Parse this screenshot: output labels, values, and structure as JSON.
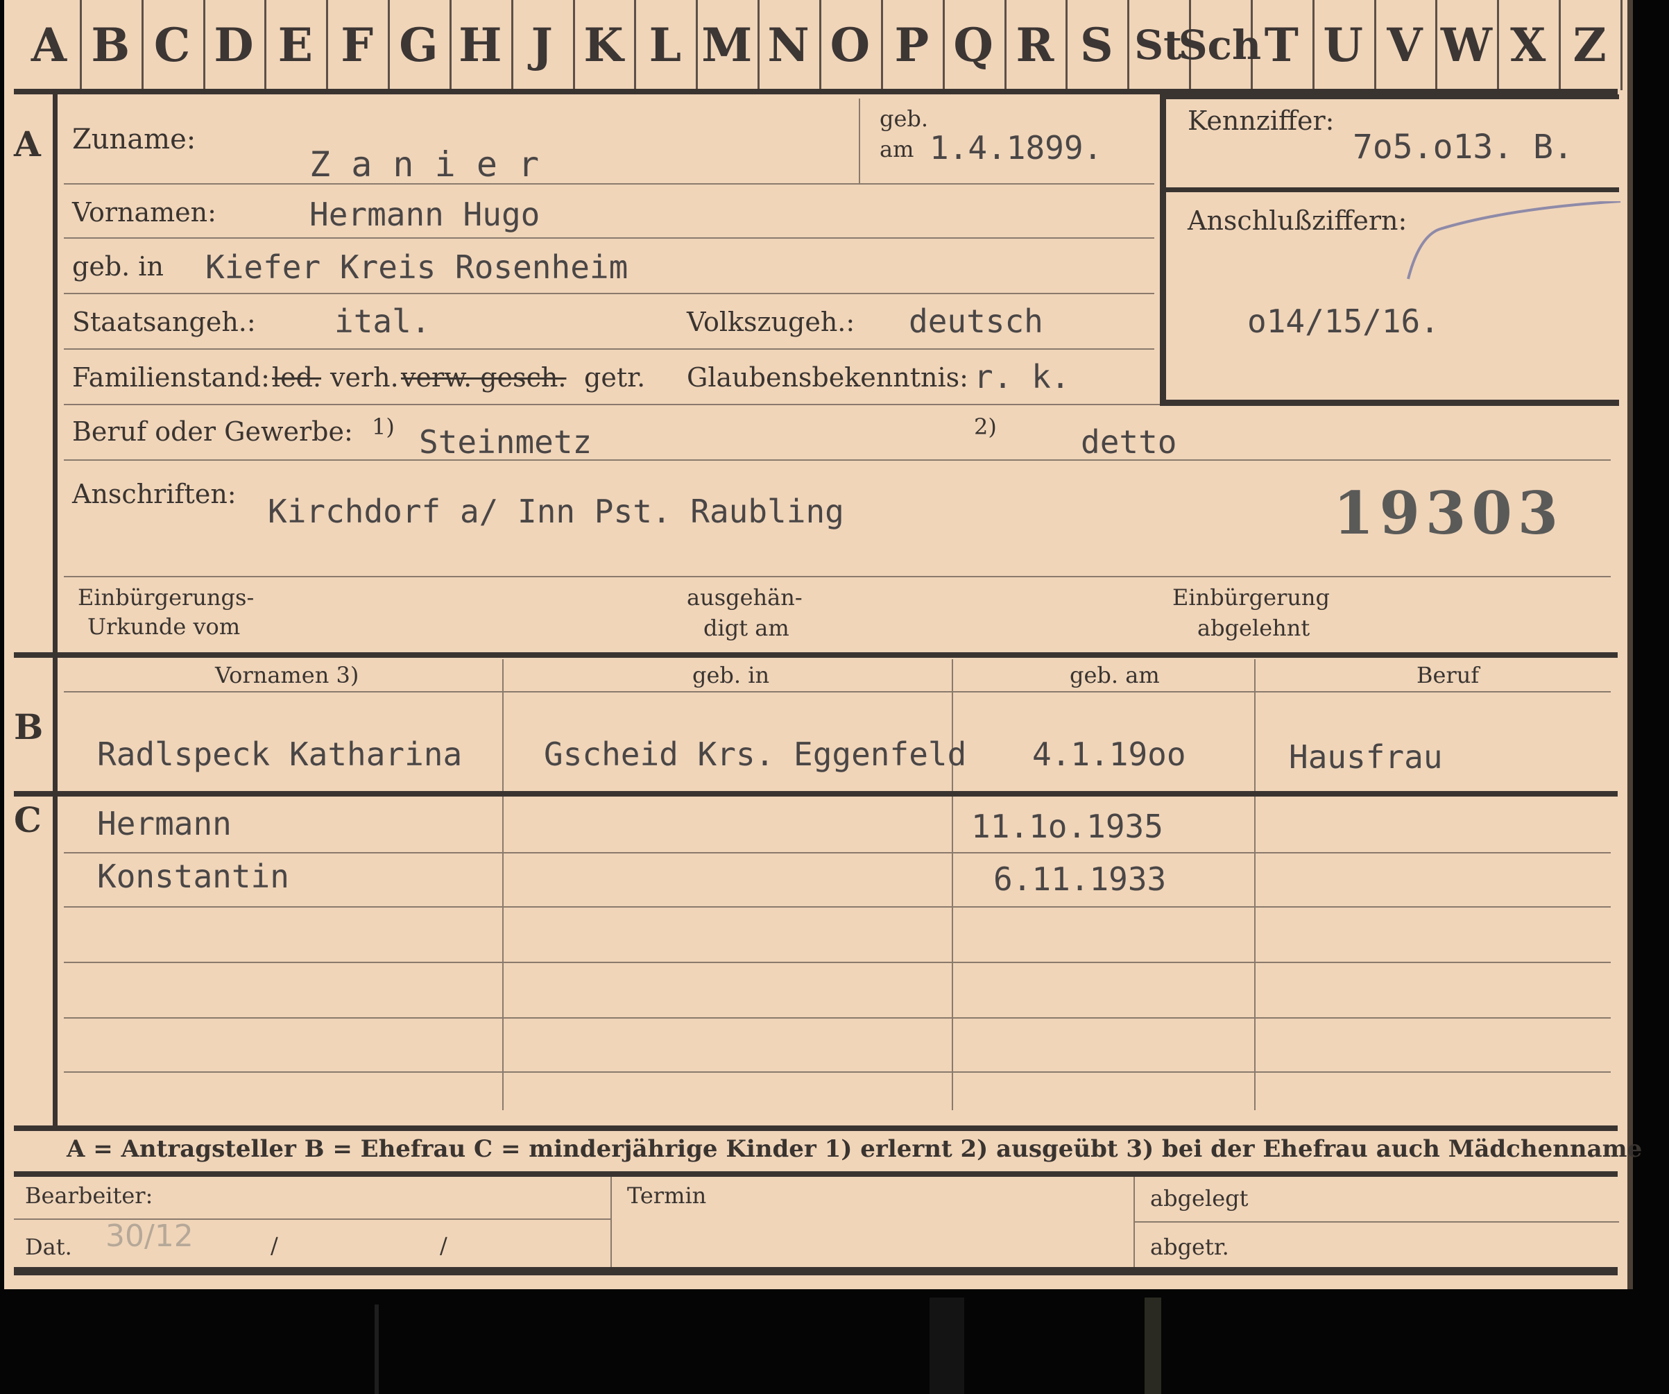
{
  "tabs": [
    "A",
    "B",
    "C",
    "D",
    "E",
    "F",
    "G",
    "H",
    "J",
    "K",
    "L",
    "M",
    "N",
    "O",
    "P",
    "Q",
    "R",
    "S",
    "St",
    "Sch",
    "T",
    "U",
    "V",
    "W",
    "X",
    "Z"
  ],
  "section_letters": {
    "a": "A",
    "b": "B",
    "c": "C"
  },
  "applicant": {
    "surname_label": "Zuname:",
    "surname": "Z a n i e r",
    "born_on_label_1": "geb.",
    "born_on_label_2": "am",
    "born_on": "1.4.1899.",
    "id_label": "Kennziffer:",
    "id_value": "7o5.o13. B.",
    "linked_label": "Anschlußziffern:",
    "linked_value": "o14/15/16.",
    "first_names_label": "Vornamen:",
    "first_names": "Hermann  Hugo",
    "birthplace_label": "geb. in",
    "birthplace": "Kiefer Kreis Rosenheim",
    "citizenship_label": "Staatsangeh.:",
    "citizenship": "ital.",
    "ethnicity_label": "Volkszugeh.:",
    "ethnicity": "deutsch",
    "marital_label": "Familienstand:",
    "marital_struck_1": "led.",
    "marital_value": "verh.",
    "marital_struck_2": "verw. gesch.",
    "marital_struck_3": "getr.",
    "religion_label": "Glaubensbekenntnis:",
    "religion": "r. k.",
    "occupation_label": "Beruf oder Gewerbe:",
    "occupation_sup1": "1)",
    "occupation_1": "Steinmetz",
    "occupation_sup2": "2)",
    "occupation_2": "detto",
    "address_label": "Anschriften:",
    "address": "Kirchdorf  a/ Inn Pst.  Raubling",
    "stamp_number": "19303",
    "naturalization_label_1": "Einbürgerungs-",
    "naturalization_label_2": "Urkunde vom",
    "handed_label_1": "ausgehän-",
    "handed_label_2": "digt am",
    "refused_label_1": "Einbürgerung",
    "refused_label_2": "abgelehnt"
  },
  "table": {
    "headers": [
      "Vornamen 3)",
      "geb. in",
      "geb. am",
      "Beruf"
    ],
    "wife": {
      "names": "Radlspeck Katharina",
      "birthplace": "Gscheid Krs. Eggenfeld",
      "born_on": "4.1.19oo",
      "occupation": "Hausfrau"
    },
    "children": [
      {
        "names": "Hermann",
        "birthplace": "",
        "born_on": "11.1o.1935",
        "occupation": ""
      },
      {
        "names": "Konstantin",
        "birthplace": "",
        "born_on": "6.11.1933",
        "occupation": ""
      }
    ]
  },
  "legend": "A = Antragsteller   B = Ehefrau   C = minderjährige Kinder   1) erlernt   2) ausgeübt   3) bei der Ehefrau auch Mädchenname",
  "footer": {
    "clerk_label": "Bearbeiter:",
    "date_label": "Dat.",
    "date_value": "30/12",
    "slash": "/",
    "deadline_label": "Termin",
    "filed_label": "abgelegt",
    "filed_by_label": "abgetr."
  },
  "colors": {
    "card": "#f0d5b9",
    "ink": "#3a3430",
    "typewriter": "#4a4646",
    "background": "#050505"
  }
}
